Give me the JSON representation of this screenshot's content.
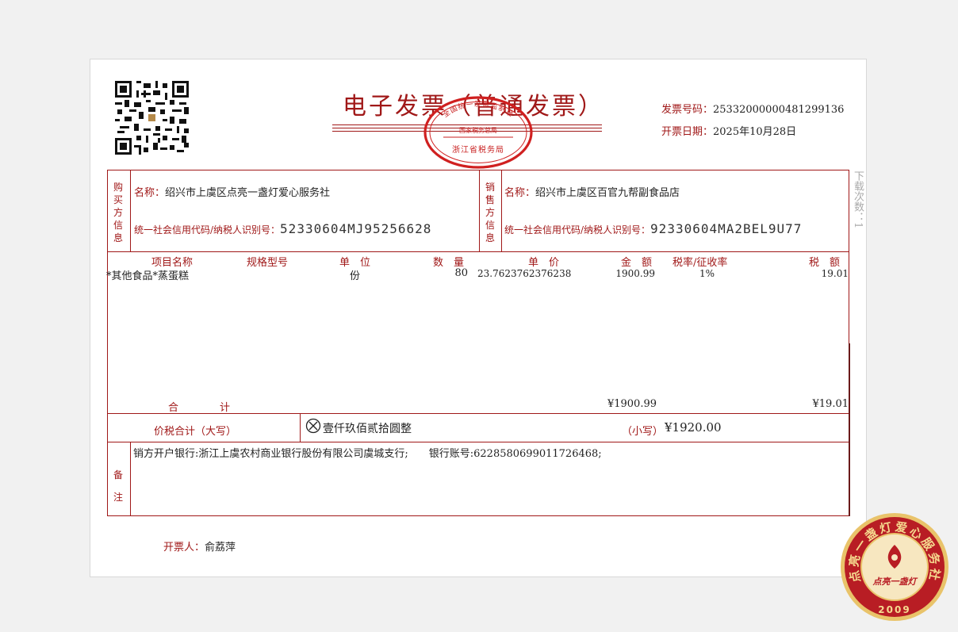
{
  "invoice": {
    "title": "电子发票（普通发票）",
    "number_label": "发票号码：",
    "number": "25332000000481299136",
    "date_label": "开票日期：",
    "date": "2025年10月28日",
    "download_count": "下载次数：1"
  },
  "stamp": {
    "top_text": "全国统一发票监制章",
    "middle_text": "国家税务总局",
    "bottom_text": "浙江省税务局"
  },
  "buyer": {
    "side_label": [
      "购",
      "买",
      "方",
      "信",
      "息"
    ],
    "name_label": "名称：",
    "name": "绍兴市上虞区点亮一盏灯爱心服务社",
    "taxid_label": "统一社会信用代码/纳税人识别号：",
    "taxid": "52330604MJ95256628"
  },
  "seller": {
    "side_label": [
      "销",
      "售",
      "方",
      "信",
      "息"
    ],
    "name_label": "名称：",
    "name": "绍兴市上虞区百官九帮副食品店",
    "taxid_label": "统一社会信用代码/纳税人识别号：",
    "taxid": "92330604MA2BEL9U77"
  },
  "items": {
    "headers": {
      "name": "项目名称",
      "spec": "规格型号",
      "unit": "单　位",
      "qty": "数　量",
      "price": "单　价",
      "amount": "金　额",
      "rate": "税率/征收率",
      "tax": "税　额"
    },
    "rows": [
      {
        "name": "*其他食品*蒸蛋糕",
        "spec": "",
        "unit": "份",
        "qty": "80",
        "price": "23.7623762376238",
        "amount": "1900.99",
        "rate": "1%",
        "tax": "19.01"
      }
    ],
    "subtotal_label": "合　　　　计",
    "subtotal_amount": "¥1900.99",
    "subtotal_tax": "¥19.01"
  },
  "total": {
    "label": "价税合计（大写）",
    "words": "壹仟玖佰贰拾圆整",
    "small_label": "（小写）",
    "small_value": "¥1920.00"
  },
  "remarks": {
    "side_label": [
      "备",
      "注"
    ],
    "text": "销方开户银行:浙江上虞农村商业银行股份有限公司虞城支行;　　银行账号:6228580699011726468;"
  },
  "issuer": {
    "label": "开票人：",
    "name": "俞荔萍"
  },
  "logo": {
    "ring_text": "点亮一盏灯爱心服务社",
    "center_text": "点亮一盏灯",
    "year": "2009"
  },
  "colors": {
    "accent": "#a01818",
    "logo_red": "#b81d24",
    "logo_gold": "#e9c36a"
  }
}
